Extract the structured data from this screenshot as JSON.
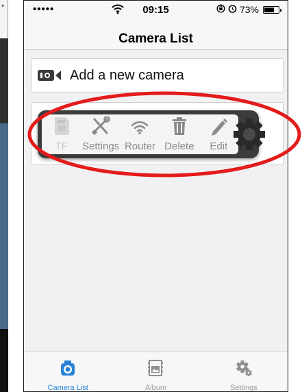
{
  "status_bar": {
    "signal": "•••••",
    "time": "09:15",
    "battery_percent": "73%",
    "battery_level": 0.73
  },
  "nav": {
    "title": "Camera List"
  },
  "add_camera": {
    "label": "Add a new camera"
  },
  "popup": {
    "actions": [
      {
        "label": "TF",
        "icon": "sd-card-icon",
        "enabled": false
      },
      {
        "label": "Settings",
        "icon": "wrench-screwdriver-icon",
        "enabled": true
      },
      {
        "label": "Router",
        "icon": "wifi-icon",
        "enabled": true
      },
      {
        "label": "Delete",
        "icon": "trash-icon",
        "enabled": true
      },
      {
        "label": "Edit",
        "icon": "pencil-icon",
        "enabled": true
      }
    ]
  },
  "tab_bar": {
    "tabs": [
      {
        "label": "Camera List",
        "icon": "camera-icon",
        "active": true
      },
      {
        "label": "Album",
        "icon": "album-icon",
        "active": false
      },
      {
        "label": "Settings",
        "icon": "gear-icon",
        "active": false
      }
    ]
  },
  "colors": {
    "accent": "#2a84d6",
    "annotation": "#e41b1b",
    "popup_background": "#3b3b3b",
    "disabled": "#c4c4c4"
  }
}
